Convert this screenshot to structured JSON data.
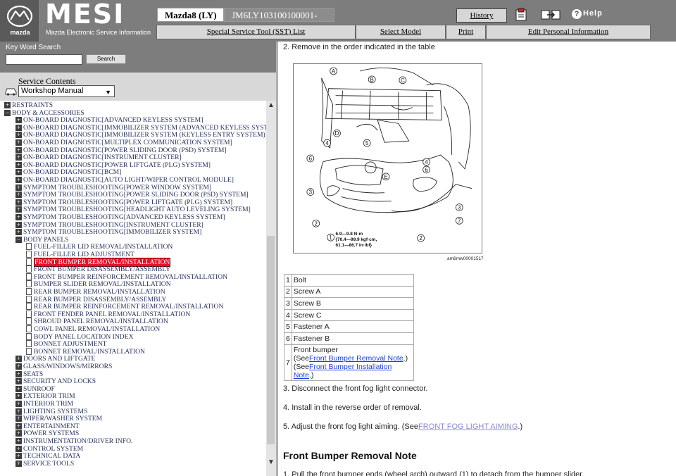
{
  "header": {
    "brand_small": "mazda",
    "title": "MESI",
    "subtitle": "Mazda Electronic Service Information",
    "model": "Mazda8 (LY)",
    "vin": "JM6LY103100100001-",
    "history_label": "History",
    "help_label": "Help"
  },
  "nav": {
    "items": [
      {
        "label": "Special Service Tool (SST) List"
      },
      {
        "label": "Select Model"
      },
      {
        "label": "Print"
      },
      {
        "label": "Edit Personal Information"
      }
    ]
  },
  "sidebar": {
    "kw_label": "Key Word Search",
    "search_label": "Search",
    "sc_label": "Service Contents",
    "manual_value": "Workshop Manual",
    "tree": [
      {
        "label": "RESTRAINTS",
        "type": "plus",
        "level": 0
      },
      {
        "label": "BODY & ACCESSORIES",
        "type": "minus",
        "level": 0
      },
      {
        "label": "ON-BOARD DIAGNOSTIC[ADVANCED KEYLESS SYSTEM]",
        "type": "plus",
        "level": 1
      },
      {
        "label": "ON-BOARD DIAGNOSTIC[IMMOBILIZER SYSTEM (ADVANCED KEYLESS SYSTE",
        "type": "plus",
        "level": 1
      },
      {
        "label": "ON-BOARD DIAGNOSTIC[IMMOBILIZER SYSTEM (KEYLESS ENTRY SYSTEM)]",
        "type": "plus",
        "level": 1
      },
      {
        "label": "ON-BOARD DIAGNOSTIC[MULTIPLEX COMMUNICATION SYSTEM]",
        "type": "plus",
        "level": 1
      },
      {
        "label": "ON-BOARD DIAGNOSTIC[POWER SLIDING DOOR (PSD) SYSTEM]",
        "type": "plus",
        "level": 1
      },
      {
        "label": "ON-BOARD DIAGNOSTIC[INSTRUMENT CLUSTER]",
        "type": "plus",
        "level": 1
      },
      {
        "label": "ON-BOARD DIAGNOSTIC[POWER LIFTGATE (PLG) SYSTEM]",
        "type": "plus",
        "level": 1
      },
      {
        "label": "ON-BOARD DIAGNOSTIC[BCM]",
        "type": "plus",
        "level": 1
      },
      {
        "label": "ON-BOARD DIAGNOSTIC[AUTO LIGHT/WIPER CONTROL MODULE]",
        "type": "plus",
        "level": 1
      },
      {
        "label": "SYMPTOM TROUBLESHOOTING[POWER WINDOW SYSTEM]",
        "type": "plus",
        "level": 1
      },
      {
        "label": "SYMPTOM TROUBLESHOOTING[POWER SLIDING DOOR (PSD) SYSTEM]",
        "type": "plus",
        "level": 1
      },
      {
        "label": "SYMPTOM TROUBLESHOOTING[POWER LIFTGATE (PLG) SYSTEM]",
        "type": "plus",
        "level": 1
      },
      {
        "label": "SYMPTOM TROUBLESHOOTING[HEADLIGHT AUTO LEVELING SYSTEM]",
        "type": "plus",
        "level": 1
      },
      {
        "label": "SYMPTOM TROUBLESHOOTING[ADVANCED KEYLESS SYSTEM]",
        "type": "plus",
        "level": 1
      },
      {
        "label": "SYMPTOM TROUBLESHOOTING[INSTRUMENT CLUSTER]",
        "type": "plus",
        "level": 1
      },
      {
        "label": "SYMPTOM TROUBLESHOOTING[IMMOBILIZER SYSTEM]",
        "type": "plus",
        "level": 1
      },
      {
        "label": "BODY PANELS",
        "type": "minus",
        "level": 1
      },
      {
        "label": "FUEL-FILLER LID REMOVAL/INSTALLATION",
        "type": "doc",
        "level": 2
      },
      {
        "label": "FUEL-FILLER LID ADJUSTMENT",
        "type": "doc",
        "level": 2
      },
      {
        "label": "FRONT BUMPER REMOVAL/INSTALLATION",
        "type": "doc",
        "level": 2,
        "selected": true
      },
      {
        "label": "FRONT BUMPER DISASSEMBLY/ASSEMBLY",
        "type": "doc",
        "level": 2
      },
      {
        "label": "FRONT BUMPER REINFORCEMENT REMOVAL/INSTALLATION",
        "type": "doc",
        "level": 2
      },
      {
        "label": "BUMPER SLIDER REMOVAL/INSTALLATION",
        "type": "doc",
        "level": 2
      },
      {
        "label": "REAR BUMPER REMOVAL/INSTALLATION",
        "type": "doc",
        "level": 2
      },
      {
        "label": "REAR BUMPER DISASSEMBLY/ASSEMBLY",
        "type": "doc",
        "level": 2
      },
      {
        "label": "REAR BUMPER REINFORCEMENT REMOVAL/INSTALLATION",
        "type": "doc",
        "level": 2
      },
      {
        "label": "FRONT FENDER PANEL REMOVAL/INSTALLATION",
        "type": "doc",
        "level": 2
      },
      {
        "label": "SHROUD PANEL REMOVAL/INSTALLATION",
        "type": "doc",
        "level": 2
      },
      {
        "label": "COWL PANEL REMOVAL/INSTALLATION",
        "type": "doc",
        "level": 2
      },
      {
        "label": "BODY PANEL LOCATION INDEX",
        "type": "doc",
        "level": 2
      },
      {
        "label": "BONNET ADJUSTMENT",
        "type": "doc",
        "level": 2
      },
      {
        "label": "BONNET REMOVAL/INSTALLATION",
        "type": "doc",
        "level": 2
      },
      {
        "label": "DOORS AND LIFTGATE",
        "type": "plus",
        "level": 1
      },
      {
        "label": "GLASS/WINDOWS/MIRRORS",
        "type": "plus",
        "level": 1
      },
      {
        "label": "SEATS",
        "type": "plus",
        "level": 1
      },
      {
        "label": "SECURITY AND LOCKS",
        "type": "plus",
        "level": 1
      },
      {
        "label": "SUNROOF",
        "type": "plus",
        "level": 1
      },
      {
        "label": "EXTERIOR TRIM",
        "type": "plus",
        "level": 1
      },
      {
        "label": "INTERIOR TRIM",
        "type": "plus",
        "level": 1
      },
      {
        "label": "LIGHTING SYSTEMS",
        "type": "plus",
        "level": 1
      },
      {
        "label": "WIPER/WASHER SYSTEM",
        "type": "plus",
        "level": 1
      },
      {
        "label": "ENTERTAINMENT",
        "type": "plus",
        "level": 1
      },
      {
        "label": "POWER SYSTEMS",
        "type": "plus",
        "level": 1
      },
      {
        "label": "INSTRUMENTATION/DRIVER INFO.",
        "type": "plus",
        "level": 1
      },
      {
        "label": "CONTROL SYSTEM",
        "type": "plus",
        "level": 1
      },
      {
        "label": "TECHNICAL DATA",
        "type": "plus",
        "level": 1
      },
      {
        "label": "SERVICE TOOLS",
        "type": "plus",
        "level": 1
      }
    ]
  },
  "content": {
    "step2": "2.  Remove in the order indicated in the table",
    "figure": {
      "callouts": [
        "A",
        "B",
        "C",
        "D",
        "E",
        "1",
        "2",
        "2",
        "3",
        "3",
        "4",
        "4",
        "5",
        "6",
        "6",
        "7"
      ],
      "torque_lines": [
        "6.9—9.8 N·m",
        "{70.4—99.9 kgf·cm,",
        "61.1—86.7 in·lbf}"
      ],
      "fig_id": "am6mw00001517"
    },
    "parts": [
      {
        "n": "1",
        "t": "Bolt"
      },
      {
        "n": "2",
        "t": "Screw A"
      },
      {
        "n": "3",
        "t": "Screw B"
      },
      {
        "n": "4",
        "t": "Screw C"
      },
      {
        "n": "5",
        "t": "Fastener A"
      },
      {
        "n": "6",
        "t": "Fastener B"
      }
    ],
    "part7": {
      "n": "7",
      "t": "Front bumper",
      "see1_pre": "(See",
      "see1_link": "Front Bumper Removal Note",
      "see1_post": ".)",
      "see2_pre": "(See",
      "see2_link": "Front Bumper Installation Note",
      "see2_post": ".)"
    },
    "step3": "3.  Disconnect the front fog light connector.",
    "step4": "4.  Install in the reverse order of removal.",
    "step5_pre": "5.  Adjust the front fog light aiming. (See",
    "step5_link": "FRONT FOG LIGHT AIMING",
    "step5_post": ".)",
    "note_heading": "Front Bumper Removal Note",
    "note_step1": "1.  Pull the front bumper ends (wheel arch) outward (1) to detach from the bumper slider."
  },
  "colors": {
    "header_gray": "#7d7d7d",
    "selected_red": "#e8122a",
    "tree_text": "#25305a",
    "link_blue": "#1c3ed6"
  },
  "icons": [
    "mazda-logo-icon",
    "manual-icon",
    "transfer-icon",
    "help-icon",
    "workshop-car-icon",
    "plus-icon",
    "minus-icon",
    "document-icon",
    "scroll-up-icon",
    "scroll-down-icon"
  ]
}
